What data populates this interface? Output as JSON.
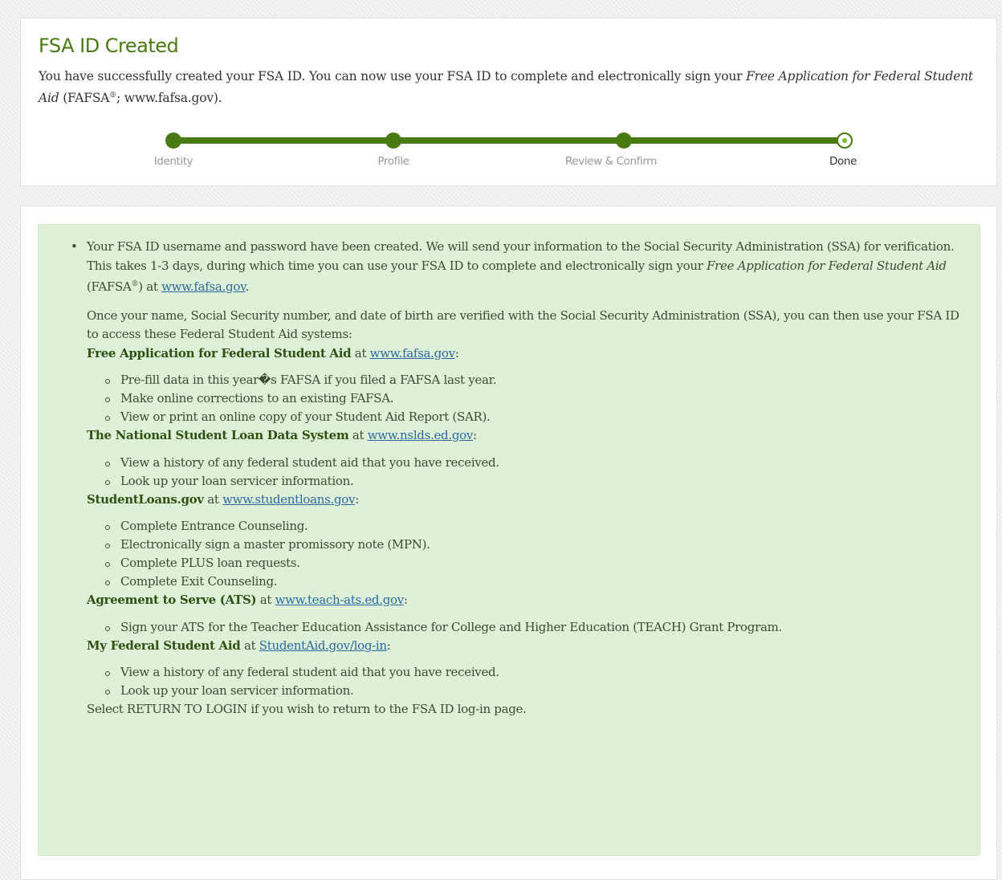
{
  "header": {
    "title": "FSA ID Created",
    "intro_before": "You have successfully created your FSA ID. You can now use your FSA ID to complete and electronically sign your ",
    "intro_italic": "Free Application for Federal Student Aid",
    "intro_paren": " (FAFSA",
    "intro_reg": "®",
    "intro_after": "; www.fafsa.gov)."
  },
  "stepper": {
    "steps": [
      {
        "label": "Identity",
        "state": "complete"
      },
      {
        "label": "Profile",
        "state": "complete"
      },
      {
        "label": "Review & Confirm",
        "state": "complete"
      },
      {
        "label": "Done",
        "state": "current"
      }
    ],
    "colors": {
      "track": "#4a7a12",
      "current_inner": "#7cbf2f"
    }
  },
  "message": {
    "bullet": "•",
    "p1_before": "Your FSA ID username and password have been created. We will send your information to the Social Security Administration (SSA) for verification. This takes 1-3 days, during which time you can use your FSA ID to complete and electronically sign your ",
    "p1_italic": "Free Application for Federal Student Aid",
    "p1_paren": " (FAFSA",
    "p1_reg": "®",
    "p1_at": ") at ",
    "p1_link": "www.fafsa.gov",
    "p1_end": ".",
    "p2": "Once your name, Social Security number, and date of birth are verified with the Social Security Administration (SSA), you can then use your FSA ID to access these Federal Student Aid systems:",
    "at": " at ",
    "colon": ":",
    "sections": [
      {
        "title": "Free Application for Federal Student Aid",
        "link": "www.fafsa.gov",
        "items": [
          "Pre-fill data in this year�s FAFSA if you filed a FAFSA last year.",
          "Make online corrections to an existing FAFSA.",
          "View or print an online copy of your Student Aid Report (SAR)."
        ]
      },
      {
        "title": "The National Student Loan Data System",
        "link": "www.nslds.ed.gov",
        "items": [
          "View a history of any federal student aid that you have received.",
          "Look up your loan servicer information."
        ]
      },
      {
        "title": "StudentLoans.gov",
        "link": "www.studentloans.gov",
        "items": [
          "Complete Entrance Counseling.",
          "Electronically sign a master promissory note (MPN).",
          "Complete PLUS loan requests.",
          "Complete Exit Counseling."
        ]
      },
      {
        "title": "Agreement to Serve (ATS)",
        "link": "www.teach-ats.ed.gov",
        "items": [
          "Sign your ATS for the Teacher Education Assistance for College and Higher Education (TEACH) Grant Program."
        ]
      },
      {
        "title": "My Federal Student Aid",
        "link": "StudentAid.gov/log-in",
        "items": [
          "View a history of any federal student aid that you have received.",
          "Look up your loan servicer information."
        ]
      }
    ],
    "footer": "Select RETURN TO LOGIN if you wish to return to the FSA ID log-in page."
  }
}
